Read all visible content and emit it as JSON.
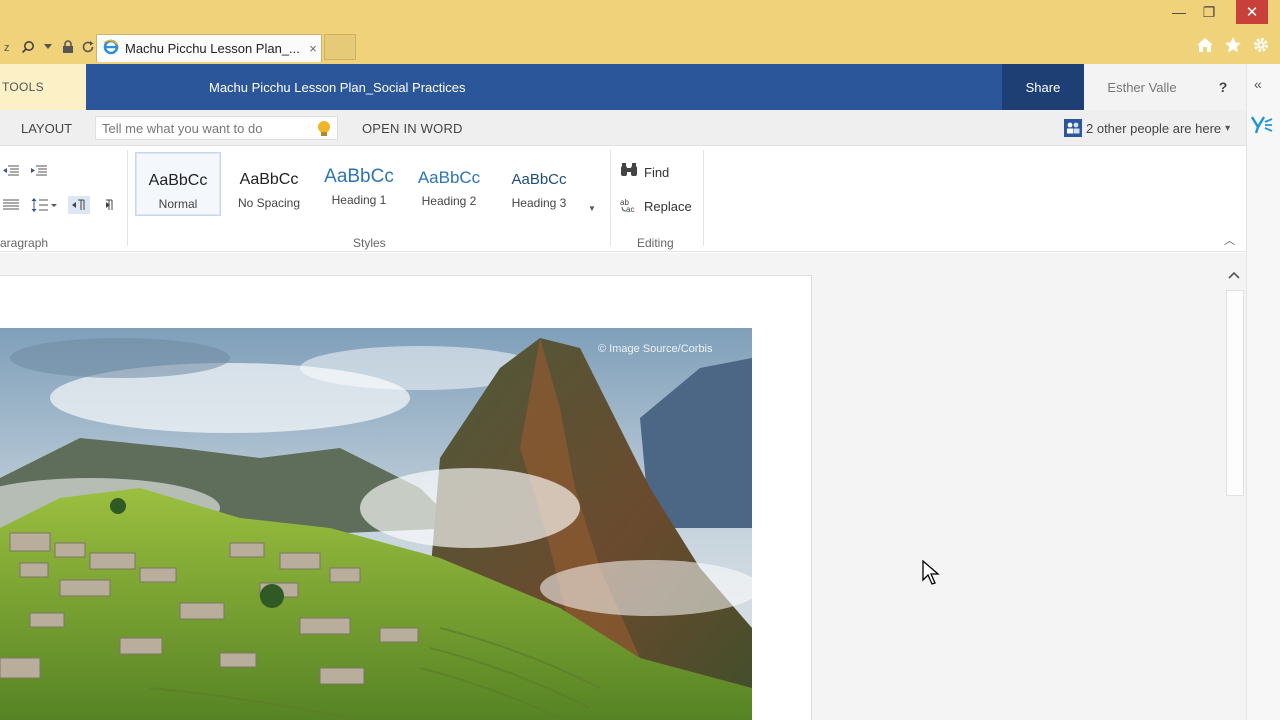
{
  "browser": {
    "tab_title": "Machu Picchu Lesson Plan_...",
    "tab_close": "×",
    "window": {
      "minimize": "—",
      "restore": "❐",
      "close": "✕"
    }
  },
  "header": {
    "tools_tab": "TOOLS",
    "document_title": "Machu Picchu Lesson Plan_Social Practices",
    "share_label": "Share",
    "user_name": "Esther Valle",
    "help_label": "?",
    "collapse_pane": "«"
  },
  "tabrow": {
    "layout_tab": "LAYOUT",
    "tell_me_placeholder": "Tell me what you want to do",
    "open_in_word": "OPEN IN WORD",
    "coauthors": "2 other people are here",
    "coauthors_chevron": "▾"
  },
  "ribbon": {
    "paragraph_group": "aragraph",
    "styles_group": "Styles",
    "editing_group": "Editing",
    "styles": [
      {
        "sample": "AaBbCc",
        "name": "Normal"
      },
      {
        "sample": "AaBbCc",
        "name": "No Spacing"
      },
      {
        "sample": "AaBbCc",
        "name": "Heading 1"
      },
      {
        "sample": "AaBbCc",
        "name": "Heading 2"
      },
      {
        "sample": "AaBbCc",
        "name": "Heading 3"
      }
    ],
    "find_label": "Find",
    "replace_label": "Replace",
    "more_styles": "▼",
    "collapse_ribbon": "︿"
  },
  "document": {
    "photo_credit": "© Image Source/Corbis"
  },
  "colors": {
    "titlebar": "#f0d27a",
    "word_blue": "#2b579a",
    "share_dark": "#1e3f74",
    "close_red": "#c9403a",
    "heading_blue": "#2e74b5"
  },
  "icons": [
    "search-icon",
    "lock-icon",
    "refresh-icon",
    "ie-icon",
    "home-icon",
    "star-icon",
    "gear-icon",
    "lightbulb-icon",
    "people-icon",
    "find-icon",
    "replace-icon",
    "yammer-icon"
  ]
}
